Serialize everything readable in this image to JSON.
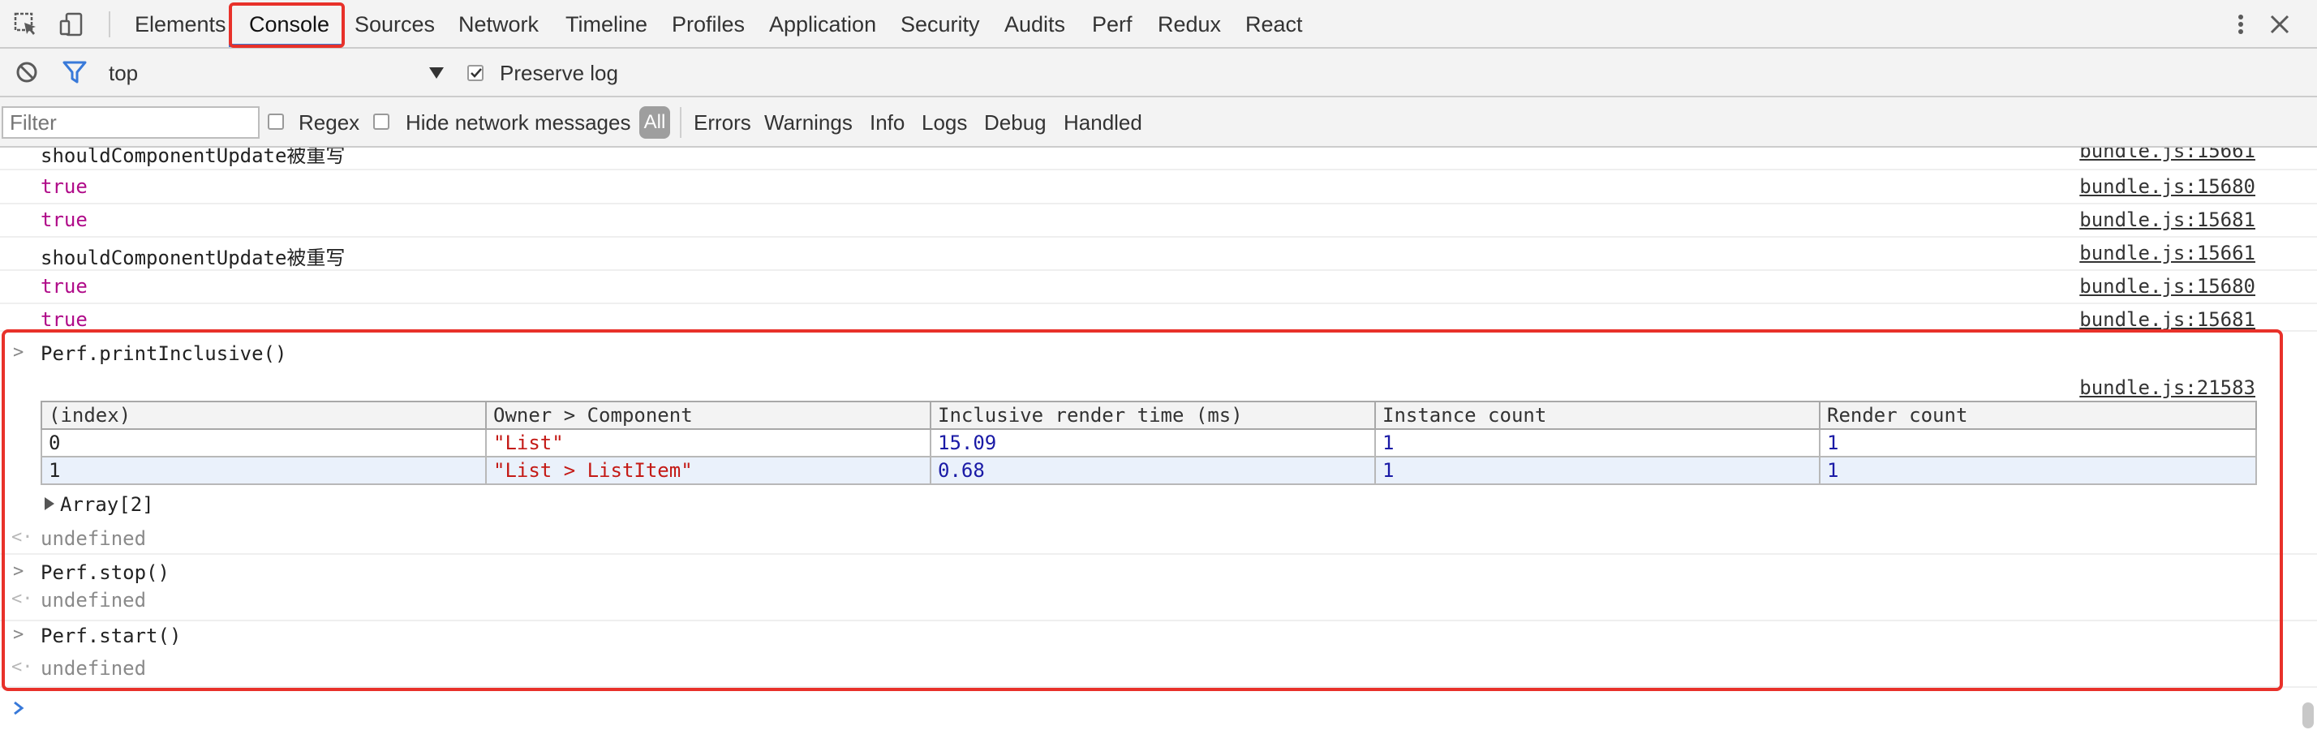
{
  "tabs": [
    "Elements",
    "Console",
    "Sources",
    "Network",
    "Timeline",
    "Profiles",
    "Application",
    "Security",
    "Audits",
    "Perf",
    "Redux",
    "React"
  ],
  "active_tab": "Console",
  "context": {
    "value": "top",
    "preserve_log_label": "Preserve log",
    "preserve_log_checked": true
  },
  "filter": {
    "placeholder": "Filter",
    "regex_label": "Regex",
    "hide_network_label": "Hide network messages",
    "all_label": "All",
    "levels": [
      "Errors",
      "Warnings",
      "Info",
      "Logs",
      "Debug",
      "Handled"
    ]
  },
  "log": [
    {
      "text": "shouldComponentUpdate被重写",
      "source": "bundle.js:15661",
      "kind": "string"
    },
    {
      "text": "true",
      "source": "bundle.js:15680",
      "kind": "boolean"
    },
    {
      "text": "true",
      "source": "bundle.js:15681",
      "kind": "boolean"
    },
    {
      "text": "shouldComponentUpdate被重写",
      "source": "bundle.js:15661",
      "kind": "string"
    },
    {
      "text": "true",
      "source": "bundle.js:15680",
      "kind": "boolean"
    },
    {
      "text": "true",
      "source": "bundle.js:15681",
      "kind": "boolean"
    }
  ],
  "perf_block": {
    "command1": "Perf.printInclusive()",
    "table_source": "bundle.js:21583",
    "table": {
      "headers": [
        "(index)",
        "Owner > Component",
        "Inclusive render time (ms)",
        "Instance count",
        "Render count"
      ],
      "rows": [
        [
          "0",
          "\"List\"",
          "15.09",
          "1",
          "1"
        ],
        [
          "1",
          "\"List > ListItem\"",
          "0.68",
          "1",
          "1"
        ]
      ]
    },
    "array_label": "Array[2]",
    "result1": "undefined",
    "command2": "Perf.stop()",
    "result2": "undefined",
    "command3": "Perf.start()",
    "result3": "undefined"
  },
  "colors": {
    "highlight": "#e8312a",
    "boolean": "#b00b89",
    "string": "#c41a16",
    "number": "#1a1aa6",
    "accent": "#3879d9"
  }
}
